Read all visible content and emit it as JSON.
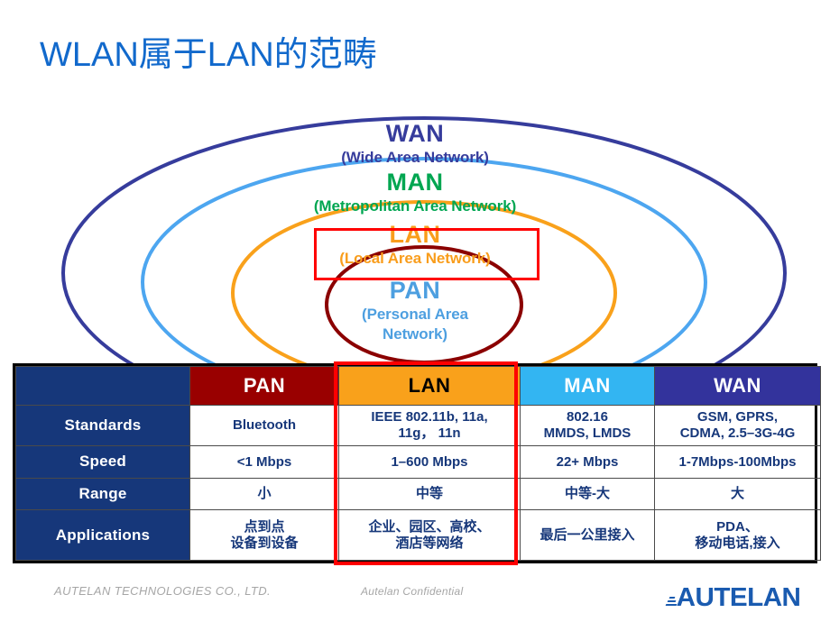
{
  "slide": {
    "title": "WLAN属于LAN的范畴",
    "title_color": "#1169cc",
    "background": "#ffffff"
  },
  "diagram": {
    "type": "nested-ellipses",
    "rings": [
      {
        "id": "wan",
        "name": "WAN",
        "subtitle": "(Wide Area Network)",
        "color": "#363c9c"
      },
      {
        "id": "man",
        "name": "MAN",
        "subtitle": "(Metropolitan Area Network)",
        "ellipse_color": "#4da6f0",
        "color": "#00a651"
      },
      {
        "id": "lan",
        "name": "LAN",
        "subtitle": "(Local Area Network)",
        "color": "#f99d1c",
        "highlighted": true
      },
      {
        "id": "pan",
        "name": "PAN",
        "subtitle_line1": "(Personal Area",
        "subtitle_line2": "Network)",
        "ellipse_color": "#8b0000",
        "color": "#4d9fe0"
      }
    ],
    "highlight_color": "#ff0000"
  },
  "table": {
    "headers": [
      {
        "label": "",
        "bg": "#16377a",
        "fg": "#ffffff"
      },
      {
        "label": "PAN",
        "bg": "#990000",
        "fg": "#ffffff"
      },
      {
        "label": "LAN",
        "bg": "#f9a11b",
        "fg": "#000000"
      },
      {
        "label": "MAN",
        "bg": "#33b5f2",
        "fg": "#ffffff"
      },
      {
        "label": "WAN",
        "bg": "#33339c",
        "fg": "#ffffff"
      }
    ],
    "rows": [
      {
        "label": "Standards",
        "pan": "Bluetooth",
        "lan_line1": "IEEE 802.11b, 11a,",
        "lan_line2": "11g， 11n",
        "man_line1": "802.16",
        "man_line2": "MMDS, LMDS",
        "wan_line1": "GSM, GPRS,",
        "wan_line2": "CDMA, 2.5–3G-4G"
      },
      {
        "label": "Speed",
        "pan": "<1 Mbps",
        "lan_line1": "1–600 Mbps",
        "lan_line2": "",
        "man_line1": "22+ Mbps",
        "man_line2": "",
        "wan_line1": "1-7Mbps-100Mbps",
        "wan_line2": ""
      },
      {
        "label": "Range",
        "pan": "小",
        "lan_line1": "中等",
        "lan_line2": "",
        "man_line1": "中等-大",
        "man_line2": "",
        "wan_line1": "大",
        "wan_line2": ""
      },
      {
        "label": "Applications",
        "pan_line1": "点到点",
        "pan_line2": "设备到设备",
        "lan_line1": "企业、园区、高校、",
        "lan_line2": "酒店等网络",
        "man_line1": "最后一公里接入",
        "man_line2": "",
        "wan_line1": "PDA、",
        "wan_line2": "移动电话,接入"
      }
    ],
    "highlighted_column": "LAN",
    "highlight_color": "#ff0000"
  },
  "footer": {
    "company": "AUTELAN TECHNOLOGIES CO., LTD.",
    "confidential": "Autelan Confidential",
    "logo_text": "AUTELAN",
    "logo_color": "#1a5bb0"
  }
}
